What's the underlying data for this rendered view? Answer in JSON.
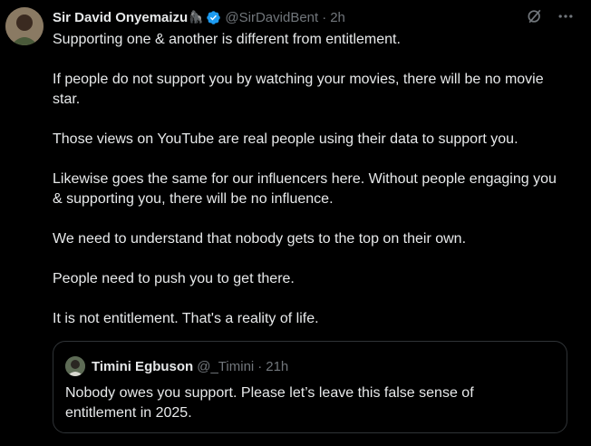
{
  "author": {
    "name": "Sir David Onyemaizu",
    "emoji": "🦍",
    "handle": "@SirDavidBent",
    "separator": "·",
    "time": "2h"
  },
  "paragraphs": [
    "Supporting one & another is different from entitlement.",
    "If people do not support you by watching your movies, there will be no movie star.",
    "Those views on YouTube are real people using their data to support you.",
    "Likewise goes the same for our influencers here. Without people engaging you & supporting you, there will be no influence.",
    "We need to understand that nobody gets to the top on their own.",
    "People need to push you to get there.",
    "It is not entitlement. That's a reality of life."
  ],
  "quote": {
    "name": "Timini Egbuson",
    "handle": "@_Timini",
    "separator": "·",
    "time": "21h",
    "text": "Nobody owes you support. Please let’s leave  this false sense of entitlement in 2025."
  },
  "icons": {
    "verified": "verified-badge-icon",
    "grok": "grok-icon",
    "more": "more-options-icon"
  },
  "colors": {
    "background": "#000000",
    "text": "#e7e9ea",
    "muted": "#71767b",
    "verified": "#1d9bf0",
    "border": "#2f3336"
  }
}
